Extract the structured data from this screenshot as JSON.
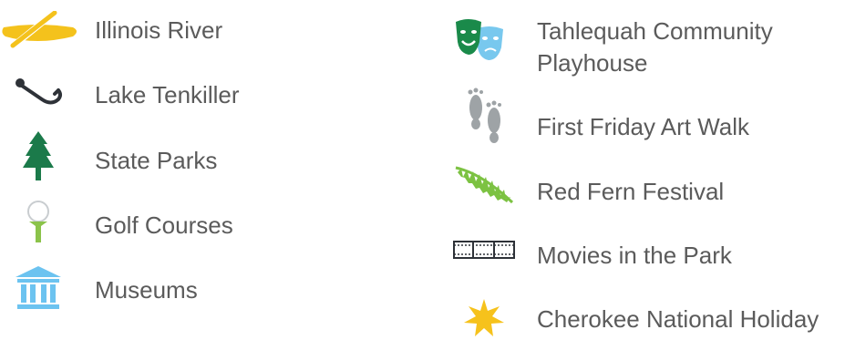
{
  "left_column": {
    "items": [
      {
        "label": "Illinois River",
        "icon": "canoe-paddle-icon",
        "color": "#f4c21c"
      },
      {
        "label": "Lake Tenkiller",
        "icon": "fishing-hook-icon",
        "color": "#2e3238"
      },
      {
        "label": "State Parks",
        "icon": "pine-tree-icon",
        "color": "#1b7a4a"
      },
      {
        "label": "Golf Courses",
        "icon": "golf-ball-tee-icon",
        "color": "#8bc34a"
      },
      {
        "label": "Museums",
        "icon": "museum-building-icon",
        "color": "#6cc3f0"
      }
    ]
  },
  "right_column": {
    "items": [
      {
        "label": "Tahlequah Community",
        "label_line2": "Playhouse",
        "icon": "theater-masks-icon",
        "colors": [
          "#1a8a4a",
          "#78c8ee"
        ]
      },
      {
        "label": "First Friday Art Walk",
        "icon": "footprints-icon",
        "color": "#9ea3a6"
      },
      {
        "label": "Red Fern Festival",
        "icon": "fern-leaf-icon",
        "color": "#7cc242"
      },
      {
        "label": "Movies in the Park",
        "icon": "film-strip-icon",
        "color": "#2e3238"
      },
      {
        "label": "Cherokee National Holiday",
        "icon": "seven-point-star-icon",
        "color": "#f6c21c"
      }
    ]
  }
}
